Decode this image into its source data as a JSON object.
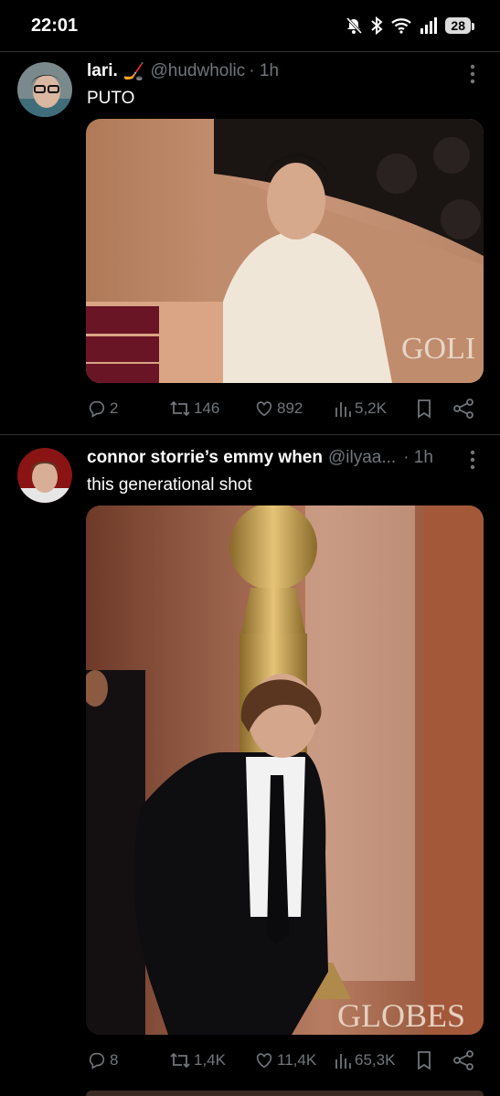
{
  "status": {
    "time": "22:01",
    "battery": "28"
  },
  "tweets": [
    {
      "name": "lari.",
      "emoji": "🏒",
      "handle": "@hudwholic",
      "time": "· 1h",
      "text": "PUTO",
      "media_text": "GOLI",
      "stats": {
        "replies": "2",
        "retweets": "146",
        "likes": "892",
        "views": "5,2K"
      }
    },
    {
      "name": "connor storrie’s emmy when",
      "handle": "@ilyaa...",
      "time": "· 1h",
      "text": "this generational shot",
      "media_text": "GLOBES",
      "stats": {
        "replies": "8",
        "retweets": "1,4K",
        "likes": "11,4K",
        "views": "65,3K"
      }
    }
  ],
  "colors": {
    "background": "#000000",
    "text": "#e7e9ea",
    "muted": "#71767b",
    "divider": "#2f3336"
  }
}
